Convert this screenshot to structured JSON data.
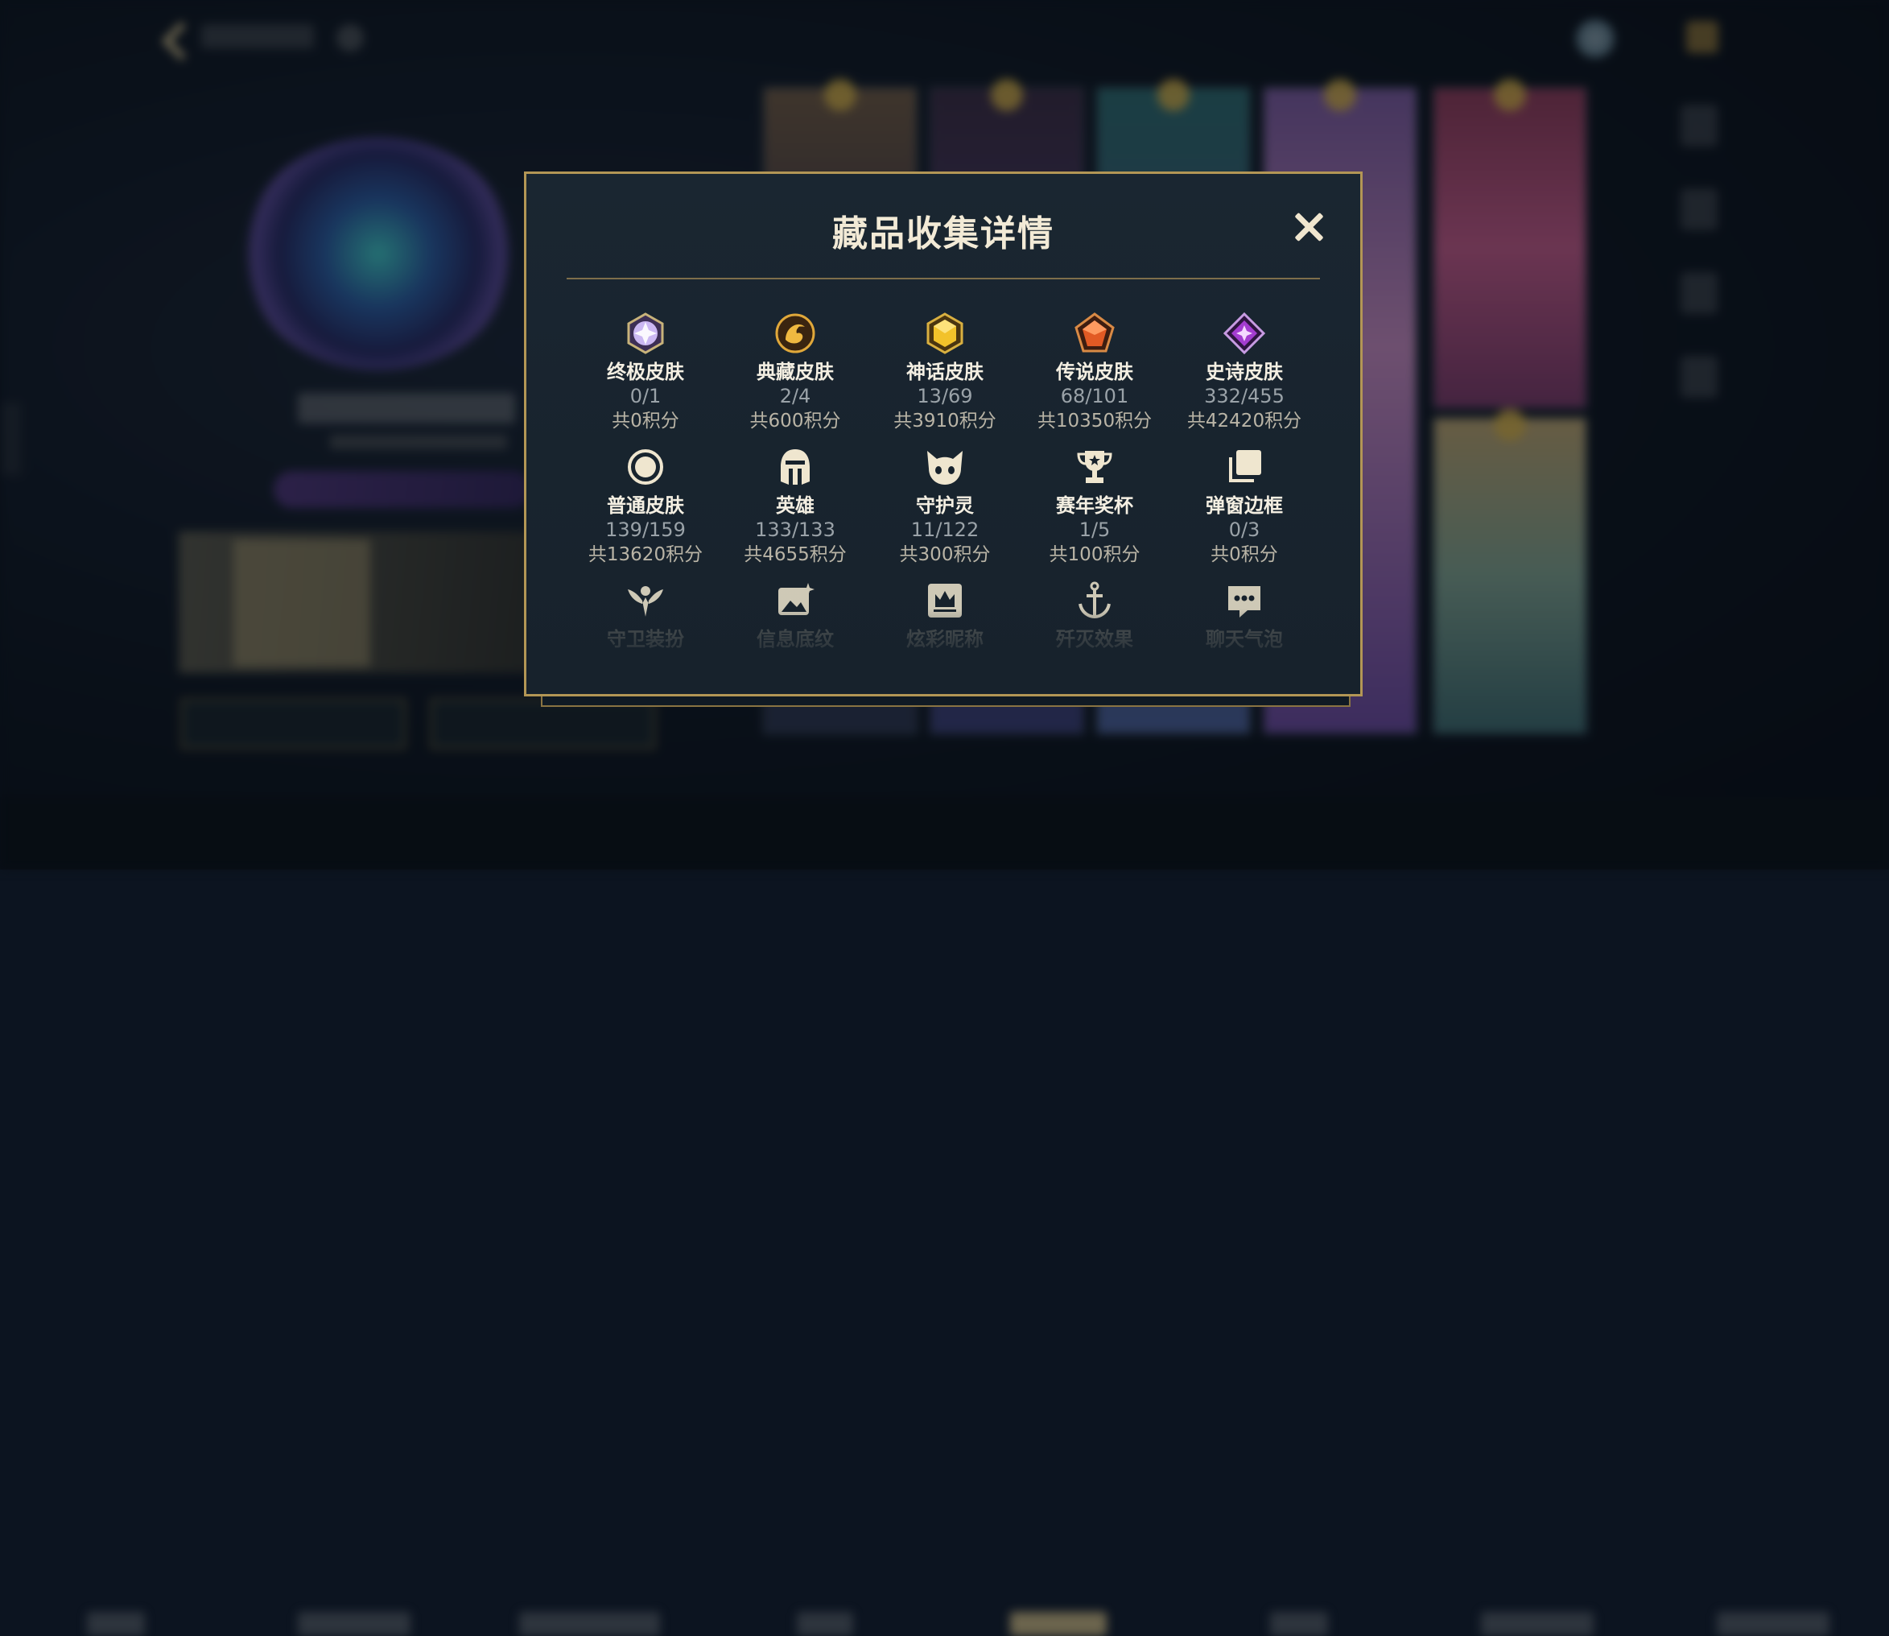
{
  "dialog": {
    "title": "藏品收集详情",
    "close_icon": "close-icon"
  },
  "rows": [
    [
      {
        "icon": "ultimate-gem-icon",
        "label": "终极皮肤",
        "count": "0/1",
        "points": "共0积分",
        "color": "#b9a3e8"
      },
      {
        "icon": "dragon-emblem-icon",
        "label": "典藏皮肤",
        "count": "2/4",
        "points": "共600积分",
        "color": "#d59a2a"
      },
      {
        "icon": "mythic-gem-icon",
        "label": "神话皮肤",
        "count": "13/69",
        "points": "共3910积分",
        "color": "#e2b322"
      },
      {
        "icon": "legend-gem-icon",
        "label": "传说皮肤",
        "count": "68/101",
        "points": "共10350积分",
        "color": "#e0592a"
      },
      {
        "icon": "epic-gem-icon",
        "label": "史诗皮肤",
        "count": "332/455",
        "points": "共42420积分",
        "color": "#a632c9"
      }
    ],
    [
      {
        "icon": "circle-icon",
        "label": "普通皮肤",
        "count": "139/159",
        "points": "共13620积分"
      },
      {
        "icon": "helmet-icon",
        "label": "英雄",
        "count": "133/133",
        "points": "共4655积分"
      },
      {
        "icon": "cat-spirit-icon",
        "label": "守护灵",
        "count": "11/122",
        "points": "共300积分"
      },
      {
        "icon": "trophy-icon",
        "label": "赛年奖杯",
        "count": "1/5",
        "points": "共100积分"
      },
      {
        "icon": "stacked-frames-icon",
        "label": "弹窗边框",
        "count": "0/3",
        "points": "共0积分"
      }
    ],
    [
      {
        "icon": "guardian-wings-icon",
        "label": "守卫装扮"
      },
      {
        "icon": "image-sparkle-icon",
        "label": "信息底纹"
      },
      {
        "icon": "crown-nameplate-icon",
        "label": "炫彩昵称"
      },
      {
        "icon": "anchor-icon",
        "label": "歼灭效果"
      },
      {
        "icon": "chat-bubble-icon",
        "label": "聊天气泡"
      }
    ]
  ],
  "colors": {
    "accent_gold": "#b39655",
    "dialog_bg": "#17222c",
    "text_primary": "#f4efe2",
    "text_muted": "#9aa2a8"
  }
}
